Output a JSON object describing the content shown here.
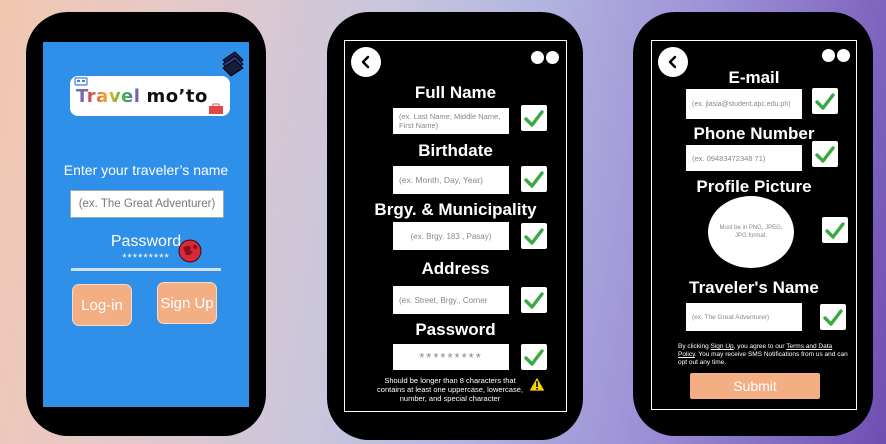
{
  "login": {
    "logo_text": {
      "part1": "Travel",
      "part2": "mo’to"
    },
    "name_prompt": "Enter your traveler’s name",
    "name_placeholder": "(ex. The Great Adventurer)",
    "password_label": "Password",
    "password_mask": "*********",
    "login_label": "Log-in",
    "signup_label": "Sign Up"
  },
  "signup1": {
    "fields": [
      {
        "label": "Full Name",
        "placeholder": "(ex. Last Name, Middle Name, First Name)"
      },
      {
        "label": "Birthdate",
        "placeholder": "(ex. Month, Day, Year)"
      },
      {
        "label": "Brgy. & Municipality",
        "placeholder": "(ex. Brgy. 183 , Pasay)"
      },
      {
        "label": "Address",
        "placeholder": "(ex. Street, Brgy., Corner"
      },
      {
        "label": "Password",
        "placeholder": "*********"
      }
    ],
    "password_hint": "Should be longer than 8 characters that contains at least one uppercase, lowercase, number, and special character"
  },
  "signup2": {
    "fields": [
      {
        "label": "E-mail",
        "placeholder": "(ex. jlasia@student.apc.edu.ph)"
      },
      {
        "label": "Phone Number",
        "placeholder": "(ex. 09483472348 71)"
      },
      {
        "label": "Profile Picture",
        "placeholder": "Must be in PNG, JPEG, JPG format."
      },
      {
        "label": "Traveler's Name",
        "placeholder": "(ex. The Great Adventurer)"
      }
    ],
    "terms": {
      "t1": "By clicking ",
      "signup_link": "Sign Up",
      "t2": ", you agree to our ",
      "terms_link": "Terms and Data Policy",
      "t3": ". You may receive SMS Notifications from us and can opt out any time."
    },
    "submit_label": "Submit"
  },
  "colors": {
    "login_bg": "#2f90ea",
    "button_peach": "#f4ae84",
    "check_green": "#3aa845"
  },
  "icons": [
    "book-icon",
    "world-map-icon",
    "back-arrow-icon",
    "menu-dots-icon",
    "checkmark-icon",
    "warning-icon"
  ]
}
